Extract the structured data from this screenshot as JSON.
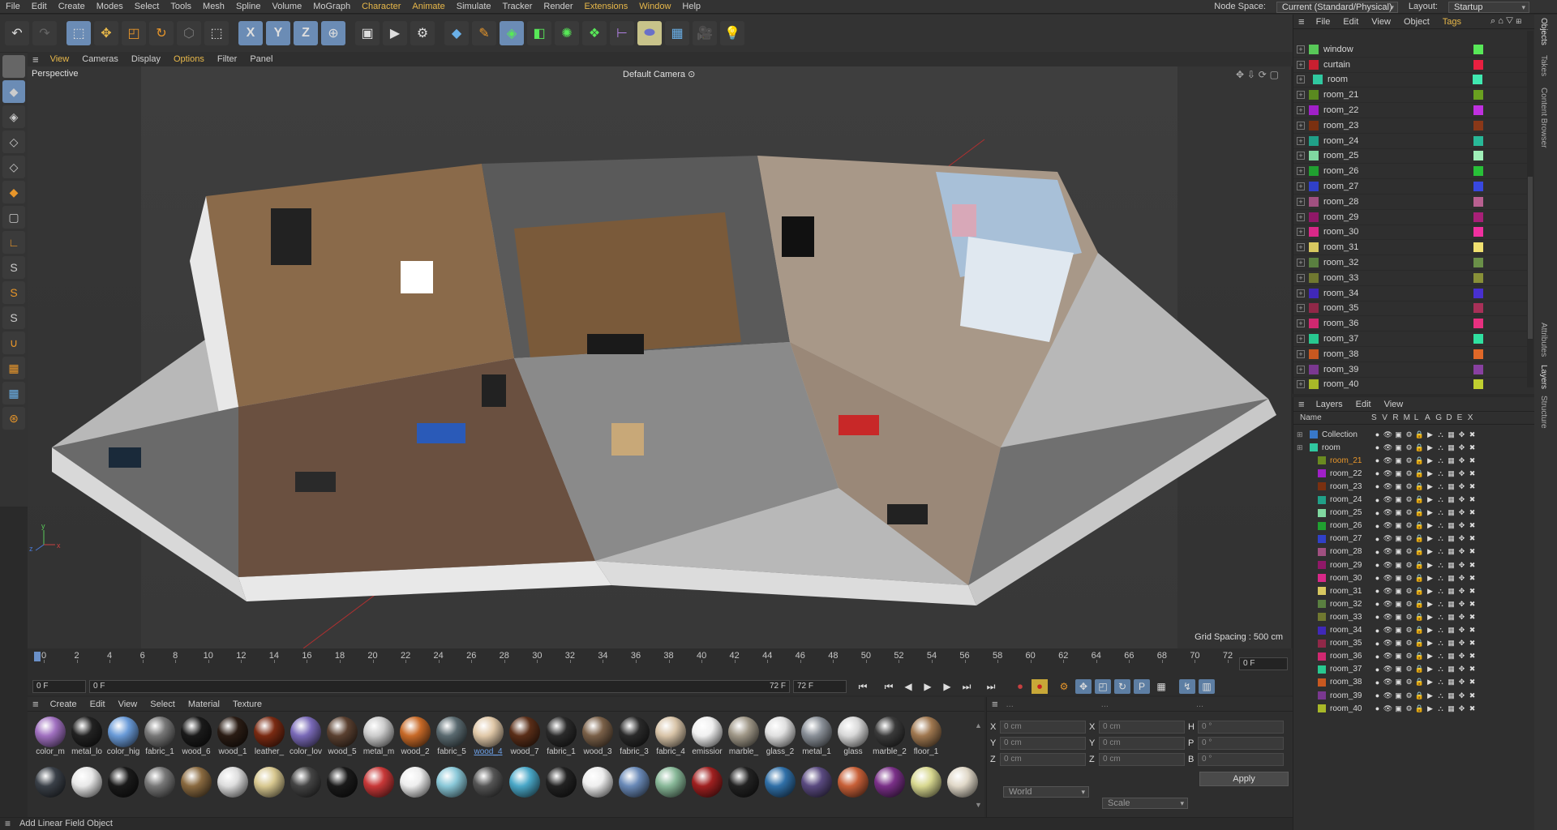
{
  "menu": [
    "File",
    "Edit",
    "Create",
    "Modes",
    "Select",
    "Tools",
    "Mesh",
    "Spline",
    "Volume",
    "MoGraph",
    "Character",
    "Animate",
    "Simulate",
    "Tracker",
    "Render",
    "Extensions",
    "Window",
    "Help"
  ],
  "menu_highlight": [
    "Character",
    "Animate",
    "Extensions",
    "Window"
  ],
  "node_space_label": "Node Space:",
  "node_space_value": "Current (Standard/Physical)",
  "layout_label": "Layout:",
  "layout_value": "Startup",
  "viewport_menu": [
    "View",
    "Cameras",
    "Display",
    "Options",
    "Filter",
    "Panel"
  ],
  "viewport_label": "Perspective",
  "camera_label": "Default Camera",
  "grid_spacing": "Grid Spacing : 500 cm",
  "ruler_ticks": [
    "0",
    "2",
    "4",
    "6",
    "8",
    "10",
    "12",
    "14",
    "16",
    "18",
    "20",
    "22",
    "24",
    "26",
    "28",
    "30",
    "32",
    "34",
    "36",
    "38",
    "40",
    "42",
    "44",
    "46",
    "48",
    "50",
    "52",
    "54",
    "56",
    "58",
    "60",
    "62",
    "64",
    "66",
    "68",
    "70",
    "72"
  ],
  "current_frame_right": "0 F",
  "play_start": "0 F",
  "play_range_start": "0 F",
  "play_range_end": "72 F",
  "play_end": "72 F",
  "mat_menu": [
    "Create",
    "Edit",
    "View",
    "Select",
    "Material",
    "Texture"
  ],
  "materials_row1": [
    {
      "name": "color_m",
      "color": "#a070c0"
    },
    {
      "name": "metal_lo",
      "color": "#222"
    },
    {
      "name": "color_hig",
      "color": "#6a9bd8"
    },
    {
      "name": "fabric_1",
      "color": "#777"
    },
    {
      "name": "wood_6",
      "color": "#1a1a1a"
    },
    {
      "name": "wood_1",
      "color": "#2a1c14"
    },
    {
      "name": "leather_",
      "color": "#7a2a12"
    },
    {
      "name": "color_lov",
      "color": "#7a6ab8"
    },
    {
      "name": "wood_5",
      "color": "#5a4030"
    },
    {
      "name": "metal_m",
      "color": "#ccc"
    },
    {
      "name": "wood_2",
      "color": "#c86a28"
    },
    {
      "name": "fabric_5",
      "color": "#5a6a70"
    },
    {
      "name": "wood_4",
      "color": "#e0c8a8"
    },
    {
      "name": "wood_7",
      "color": "#5a2e18"
    },
    {
      "name": "fabric_1",
      "color": "#2a2a2a"
    },
    {
      "name": "wood_3",
      "color": "#7a6048"
    },
    {
      "name": "fabric_3",
      "color": "#2a2a2a"
    },
    {
      "name": "fabric_4",
      "color": "#d8c4a8"
    },
    {
      "name": "emissior",
      "color": "#f0f0f0"
    },
    {
      "name": "marble_",
      "color": "#a09888"
    },
    {
      "name": "glass_2",
      "color": "#e0e0e0"
    },
    {
      "name": "metal_1",
      "color": "#8a9098"
    },
    {
      "name": "glass",
      "color": "#d8d8d8"
    },
    {
      "name": "marble_2",
      "color": "#3a3a3a"
    },
    {
      "name": "floor_1",
      "color": "#a07850"
    }
  ],
  "selected_material": "wood_4",
  "materials_row2_colors": [
    "#3a4048",
    "#e8e8e8",
    "#1a1a1a",
    "#777",
    "#8a6a40",
    "#ddd",
    "#d8c890",
    "#444",
    "#1a1a1a",
    "#c83838",
    "#eee",
    "#8ac8d8",
    "#555",
    "#4aa8c8",
    "#222",
    "#eee",
    "#6a8ab8",
    "#88b898",
    "#a02020",
    "#222",
    "#3070a8",
    "#5a4a80",
    "#c86038",
    "#7a3088",
    "#d8d890",
    "#e0d8c8"
  ],
  "coords": {
    "x": "X",
    "y": "Y",
    "z": "Z",
    "x2": "X",
    "y2": "Y",
    "z2": "Z",
    "h": "H",
    "p": "P",
    "b": "B",
    "val_cm": "0 cm",
    "val_deg": "0 °",
    "dots": "...",
    "mode1": "World",
    "mode2": "Scale",
    "apply": "Apply"
  },
  "status_text": "Add Linear Field Object",
  "obj_menu": [
    "File",
    "Edit",
    "View",
    "Object",
    "Tags"
  ],
  "objects": [
    {
      "name": "window",
      "color": "#58c858",
      "tag": "#58e858"
    },
    {
      "name": "curtain",
      "color": "#c82030",
      "tag": "#e82040"
    },
    {
      "name": "room",
      "color": "#30c8a0",
      "tag": "#40e8b0",
      "indent": 1
    },
    {
      "name": "room_21",
      "color": "#5a8a20",
      "tag": "#6aa020"
    },
    {
      "name": "room_22",
      "color": "#a020c8",
      "tag": "#c030e0"
    },
    {
      "name": "room_23",
      "color": "#7a3010",
      "tag": "#8a3818"
    },
    {
      "name": "room_24",
      "color": "#20a088",
      "tag": "#28b898"
    },
    {
      "name": "room_25",
      "color": "#80d8a0",
      "tag": "#a0f0b8"
    },
    {
      "name": "room_26",
      "color": "#20a030",
      "tag": "#28c038"
    },
    {
      "name": "room_27",
      "color": "#3040c8",
      "tag": "#3848e0"
    },
    {
      "name": "room_28",
      "color": "#a05080",
      "tag": "#b86090"
    },
    {
      "name": "room_29",
      "color": "#901868",
      "tag": "#a82078"
    },
    {
      "name": "room_30",
      "color": "#d82888",
      "tag": "#f030a0"
    },
    {
      "name": "room_31",
      "color": "#d8c860",
      "tag": "#f0e070"
    },
    {
      "name": "room_32",
      "color": "#5a8040",
      "tag": "#6a9048"
    },
    {
      "name": "room_33",
      "color": "#707830",
      "tag": "#889038"
    },
    {
      "name": "room_34",
      "color": "#4028b8",
      "tag": "#4830d0"
    },
    {
      "name": "room_35",
      "color": "#902848",
      "tag": "#a83058"
    },
    {
      "name": "room_36",
      "color": "#d02870",
      "tag": "#e83080"
    },
    {
      "name": "room_37",
      "color": "#28c890",
      "tag": "#30e0a0"
    },
    {
      "name": "room_38",
      "color": "#c85820",
      "tag": "#e06828"
    },
    {
      "name": "room_39",
      "color": "#7a3890",
      "tag": "#8840a0"
    },
    {
      "name": "room_40",
      "color": "#a8b828",
      "tag": "#c0d030"
    }
  ],
  "layer_menu": [
    "Layers",
    "Edit",
    "View"
  ],
  "layer_head": {
    "name": "Name",
    "cols": [
      "S",
      "V",
      "R",
      "M",
      "L",
      "A",
      "G",
      "D",
      "E",
      "X"
    ]
  },
  "layers": [
    {
      "name": "Collection",
      "color": "#3878c8",
      "level": 0
    },
    {
      "name": "room",
      "color": "#30c8a0",
      "level": 0
    },
    {
      "name": "room_21",
      "color": "#6a8a20",
      "level": 1,
      "selected": true
    },
    {
      "name": "room_22",
      "color": "#a020c8",
      "level": 1
    },
    {
      "name": "room_23",
      "color": "#7a3010",
      "level": 1
    },
    {
      "name": "room_24",
      "color": "#20a088",
      "level": 1
    },
    {
      "name": "room_25",
      "color": "#80d8a0",
      "level": 1
    },
    {
      "name": "room_26",
      "color": "#20a030",
      "level": 1
    },
    {
      "name": "room_27",
      "color": "#3040c8",
      "level": 1
    },
    {
      "name": "room_28",
      "color": "#a05080",
      "level": 1
    },
    {
      "name": "room_29",
      "color": "#901868",
      "level": 1
    },
    {
      "name": "room_30",
      "color": "#d82888",
      "level": 1
    },
    {
      "name": "room_31",
      "color": "#d8c860",
      "level": 1
    },
    {
      "name": "room_32",
      "color": "#5a8040",
      "level": 1
    },
    {
      "name": "room_33",
      "color": "#707830",
      "level": 1
    },
    {
      "name": "room_34",
      "color": "#4028b8",
      "level": 1
    },
    {
      "name": "room_35",
      "color": "#902848",
      "level": 1
    },
    {
      "name": "room_36",
      "color": "#d02870",
      "level": 1
    },
    {
      "name": "room_37",
      "color": "#28c890",
      "level": 1
    },
    {
      "name": "room_38",
      "color": "#c85820",
      "level": 1
    },
    {
      "name": "room_39",
      "color": "#7a3890",
      "level": 1
    },
    {
      "name": "room_40",
      "color": "#a8b828",
      "level": 1
    }
  ],
  "side_tabs": [
    "Objects",
    "Takes",
    "Content Browser",
    "Attributes",
    "Layers",
    "Structure"
  ]
}
